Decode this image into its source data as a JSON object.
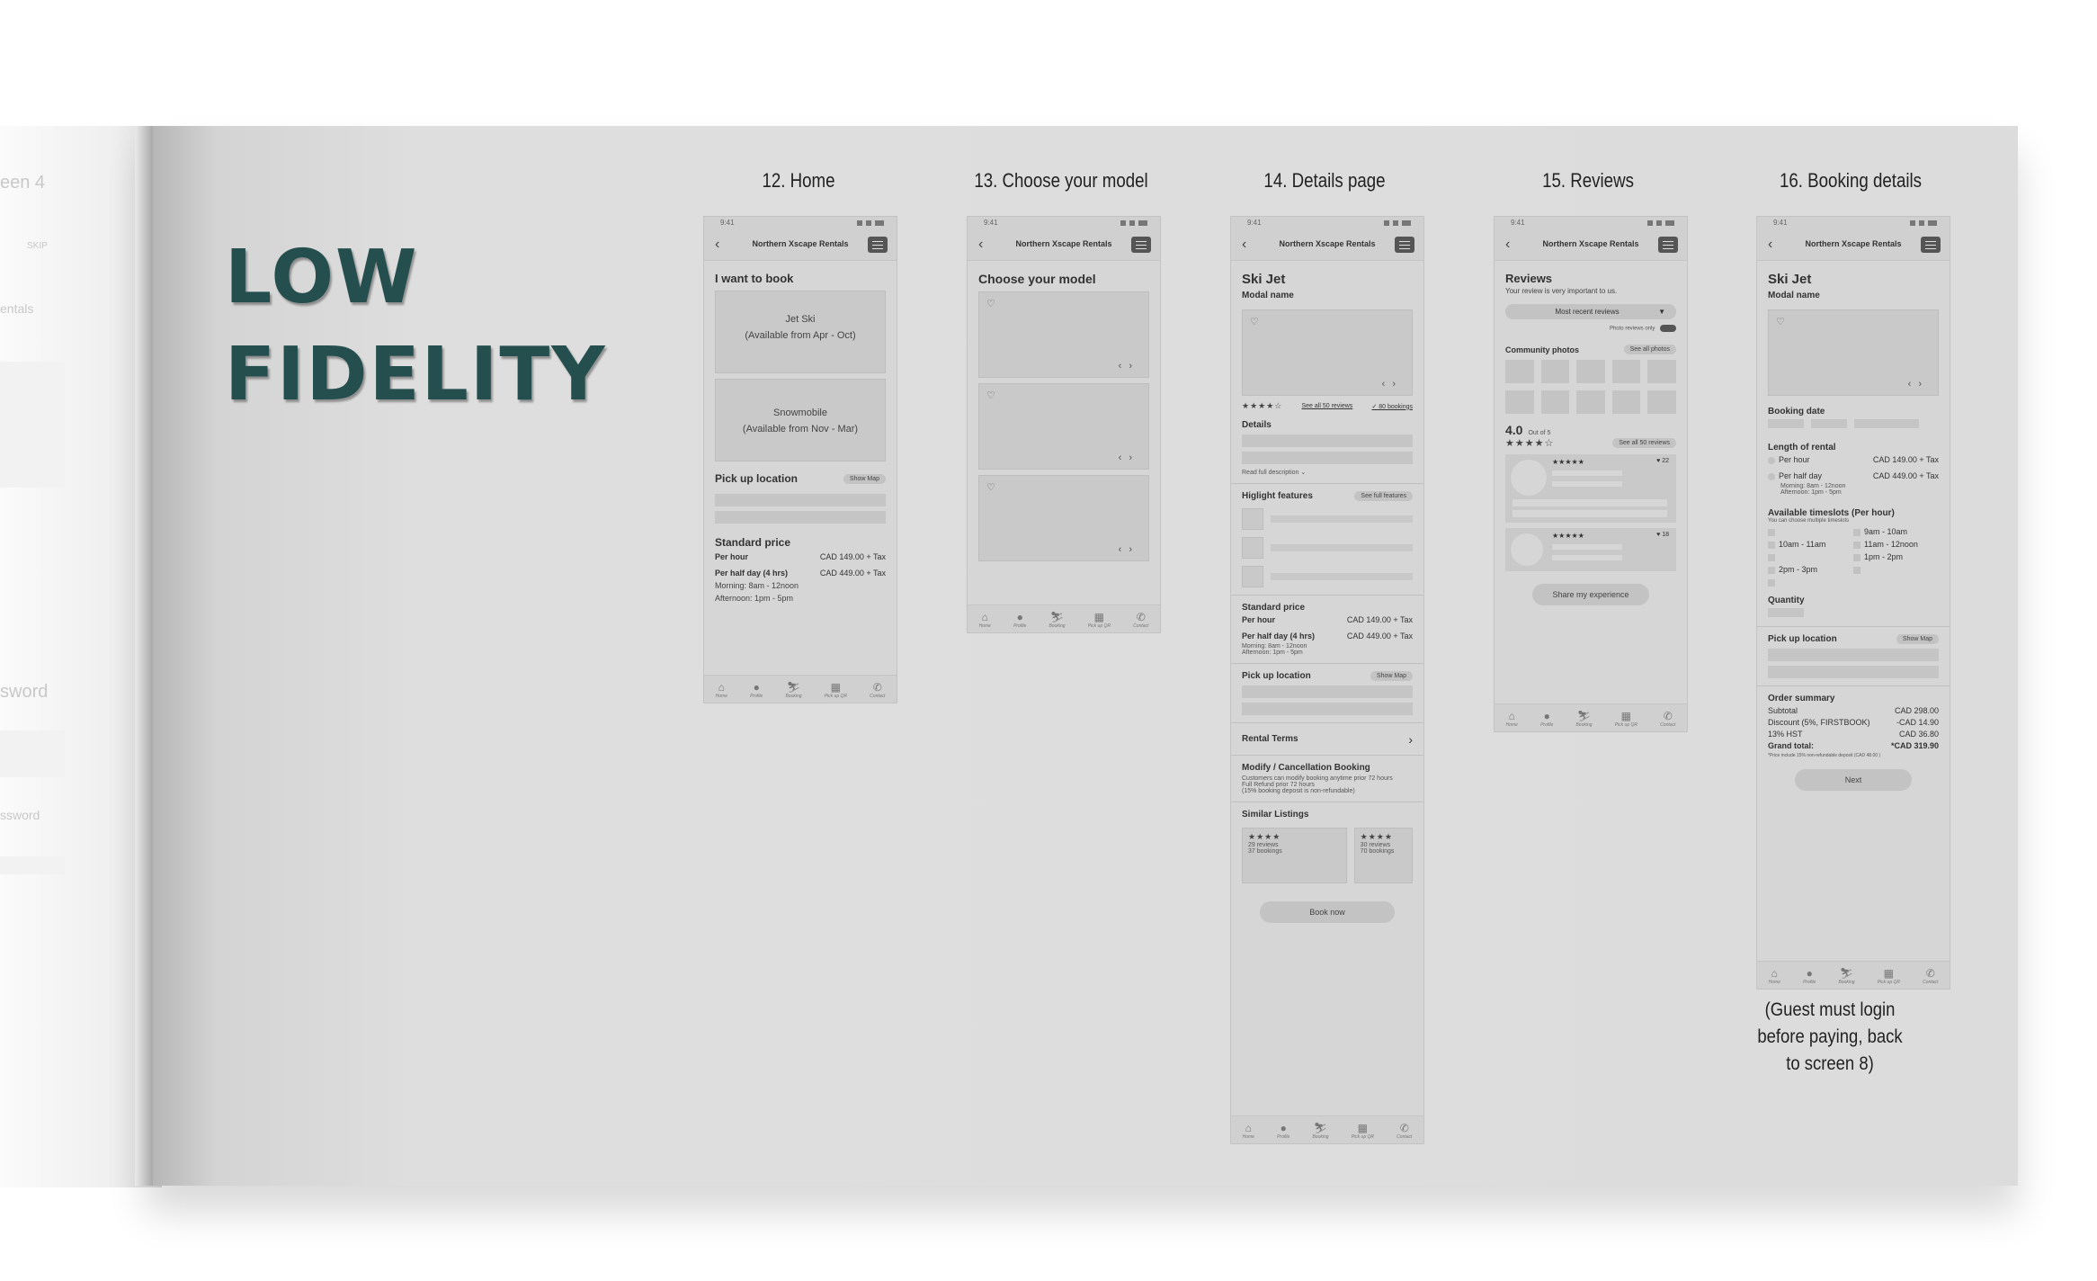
{
  "left_page": {
    "fragments": [
      "een 4",
      "SKIP",
      "entals",
      "sword",
      "ssword"
    ]
  },
  "title_lines": [
    "LOW",
    "FIDELITY"
  ],
  "screen_labels": [
    "12. Home",
    "13. Choose your model",
    "14. Details page",
    "15. Reviews",
    "16. Booking details"
  ],
  "note": "(Guest must login before paying, back to screen 8)",
  "common": {
    "time": "9:41",
    "app_name": "Northern Xscape Rentals",
    "nav": [
      "Home",
      "Profile",
      "Booking",
      "Pick up QR",
      "Contact"
    ],
    "icons": [
      "home-icon",
      "profile-icon",
      "booking-icon",
      "qr-icon",
      "phone-icon"
    ]
  },
  "home": {
    "heading": "I want to book",
    "card1_line1": "Jet Ski",
    "card1_line2": "(Available from Apr - Oct)",
    "card2_line1": "Snowmobile",
    "card2_line2": "(Available from Nov - Mar)",
    "pickup": "Pick up location",
    "show_map": "Show Map",
    "std_price": "Standard price",
    "per_hour": "Per hour",
    "per_hour_price": "CAD 149.00 + Tax",
    "half_day": "Per half day (4 hrs)",
    "half_day_price": "CAD 449.00 + Tax",
    "morning": "Morning: 8am - 12noon",
    "afternoon": "Afternoon: 1pm - 5pm"
  },
  "choose": {
    "heading": "Choose your model"
  },
  "details": {
    "title": "Ski Jet",
    "subtitle": "Modal name",
    "rating_stars": "★★★★☆",
    "see_reviews": "See all 50 reviews",
    "bookings": "✓ 80 bookings",
    "details_h": "Details",
    "read_full": "Read full description ⌄",
    "features_h": "Higlight features",
    "see_features": "See full features",
    "std_price": "Standard price",
    "per_hour": "Per hour",
    "per_hour_price": "CAD 149.00 + Tax",
    "half_day": "Per half day (4 hrs)",
    "half_day_price": "CAD 449.00 + Tax",
    "morning": "Morning: 8am - 12noon",
    "afternoon": "Afternoon: 1pm - 5pm",
    "pickup": "Pick up location",
    "show_map": "Show Map",
    "rental_terms": "Rental Terms",
    "modify_h": "Modify / Cancellation Booking",
    "modify_l1": "Customers can modify booking anytime prior 72 hours",
    "modify_l2": "Full Refund prior 72 hours",
    "modify_l3": "(15% booking deposit is non-refundable)",
    "similar": "Similar Listings",
    "sim1_stars": "★★★★",
    "sim1_reviews": "29 reviews",
    "sim1_bookings": "37 bookings",
    "sim2_stars": "★★★★",
    "sim2_reviews": "30 reviews",
    "sim2_bookings": "70 bookings",
    "book_now": "Book now"
  },
  "reviews": {
    "heading": "Reviews",
    "sub": "Your review is very important to us.",
    "sort": "Most recent reviews",
    "photo_only": "Photo reviews only",
    "community": "Community photos",
    "see_photos": "See all photos",
    "score": "4.0",
    "out_of": "Out of 5",
    "score_stars": "★★★★☆",
    "see_reviews": "See all 50 reviews",
    "r1_stars": "★★★★★",
    "r1_likes": "♥ 22",
    "r2_stars": "★★★★★",
    "r2_likes": "♥ 18",
    "share": "Share my experience"
  },
  "booking": {
    "title": "Ski Jet",
    "subtitle": "Modal name",
    "booking_date": "Booking date",
    "length": "Length of rental",
    "per_hour": "Per hour",
    "per_hour_price": "CAD 149.00 + Tax",
    "half_day": "Per half day",
    "half_day_price": "CAD 449.00 + Tax",
    "morning": "Morning: 8am - 12noon",
    "afternoon": "Afternoon: 1pm - 5pm",
    "timeslots": "Available timeslots (Per hour)",
    "timeslots_sub": "You can choose multiple timeslots",
    "slot_a2": "9am - 10am",
    "slot_b1": "10am - 11am",
    "slot_b2": "11am - 12noon",
    "slot_c2": "1pm - 2pm",
    "slot_d1": "2pm - 3pm",
    "quantity": "Quantity",
    "pickup": "Pick up location",
    "show_map": "Show Map",
    "order_summary": "Order summary",
    "subtotal": "Subtotal",
    "subtotal_v": "CAD 298.00",
    "discount": "Discount (5%, FIRSTBOOK)",
    "discount_v": "-CAD 14.90",
    "hst": "13% HST",
    "hst_v": "CAD 36.80",
    "grand": "Grand total:",
    "grand_v": "*CAD 319.90",
    "price_note": "*Price include 15% non-refundable deposit (CAD 48.00 )",
    "next": "Next"
  }
}
